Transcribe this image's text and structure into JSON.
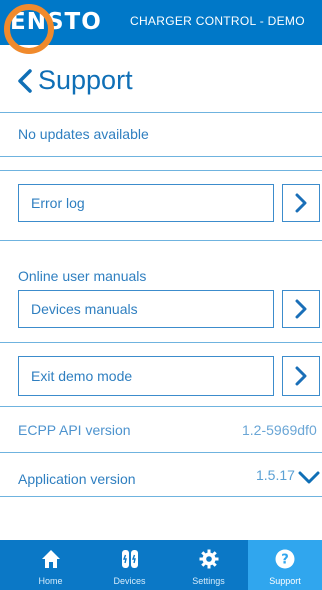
{
  "header": {
    "logo_text": "ENSTO",
    "app_title": "CHARGER CONTROL - DEMO"
  },
  "page": {
    "title": "Support"
  },
  "updates": {
    "status": "No updates available"
  },
  "error_log": {
    "label": "Error log"
  },
  "manuals": {
    "section_label": "Online user manuals",
    "button_label": "Devices manuals"
  },
  "demo": {
    "exit_label": "Exit demo mode"
  },
  "api": {
    "label": "ECPP API version",
    "value": "1.2-5969df0"
  },
  "app_version": {
    "label": "Application version",
    "value": "1.5.17"
  },
  "nav": {
    "items": [
      {
        "label": "Home",
        "icon": "home-icon"
      },
      {
        "label": "Devices",
        "icon": "devices-icon"
      },
      {
        "label": "Settings",
        "icon": "gear-icon"
      },
      {
        "label": "Support",
        "icon": "help-icon"
      }
    ],
    "active": "Support"
  },
  "colors": {
    "primary": "#0078c8",
    "accent": "#f08a2c",
    "text": "#2f7fc0",
    "nav_active": "#30a6ee"
  }
}
